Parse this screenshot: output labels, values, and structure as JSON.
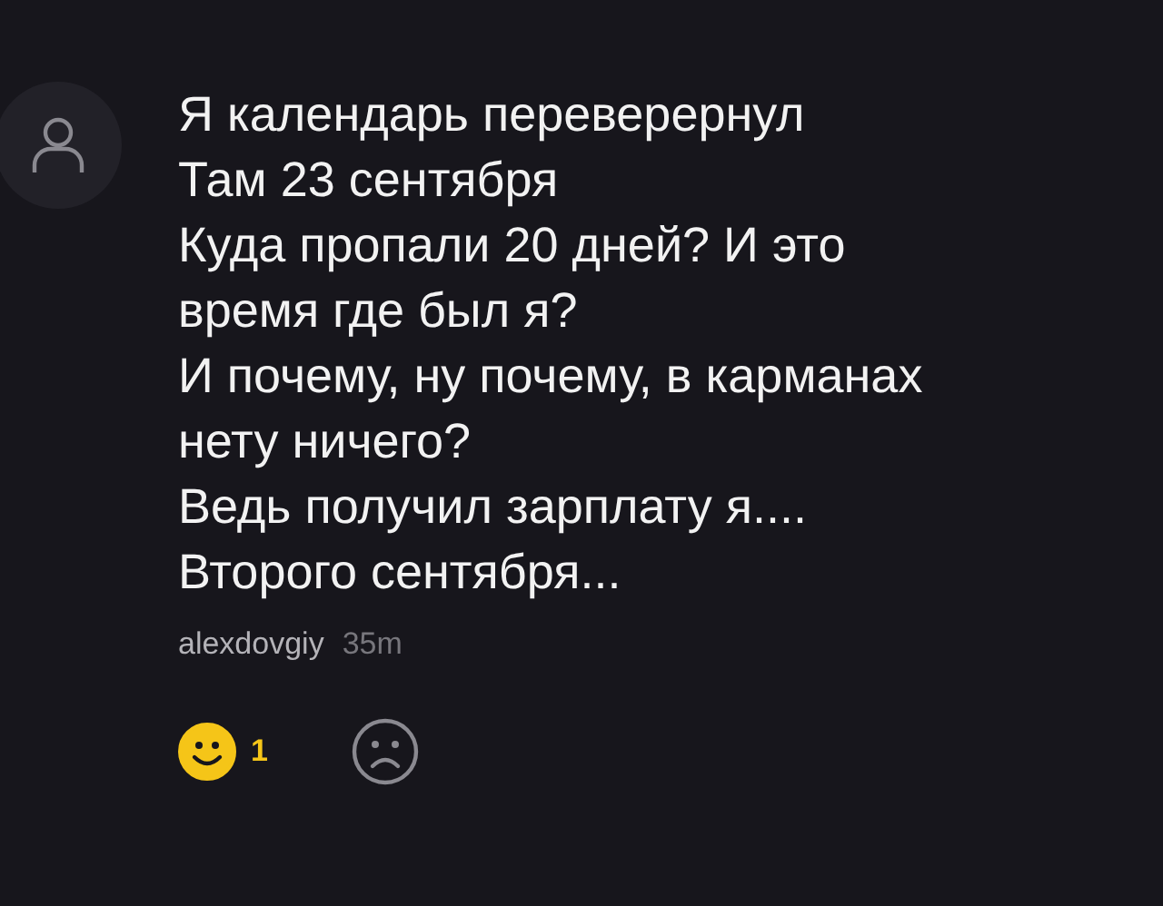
{
  "comment": {
    "lines": [
      "Я календарь переверернул",
      "Там 23 сентября",
      "Куда пропали 20 дней? И это",
      "время где был я?",
      "И почему, ну почему, в карманах",
      "нету ничего?",
      "Ведь получил зарплату я....",
      "Второго сентября..."
    ],
    "author": "alexdovgiy",
    "time": "35m",
    "reactions": [
      {
        "kind": "like",
        "selected": true,
        "count": "1"
      },
      {
        "kind": "dislike",
        "selected": false
      }
    ]
  }
}
